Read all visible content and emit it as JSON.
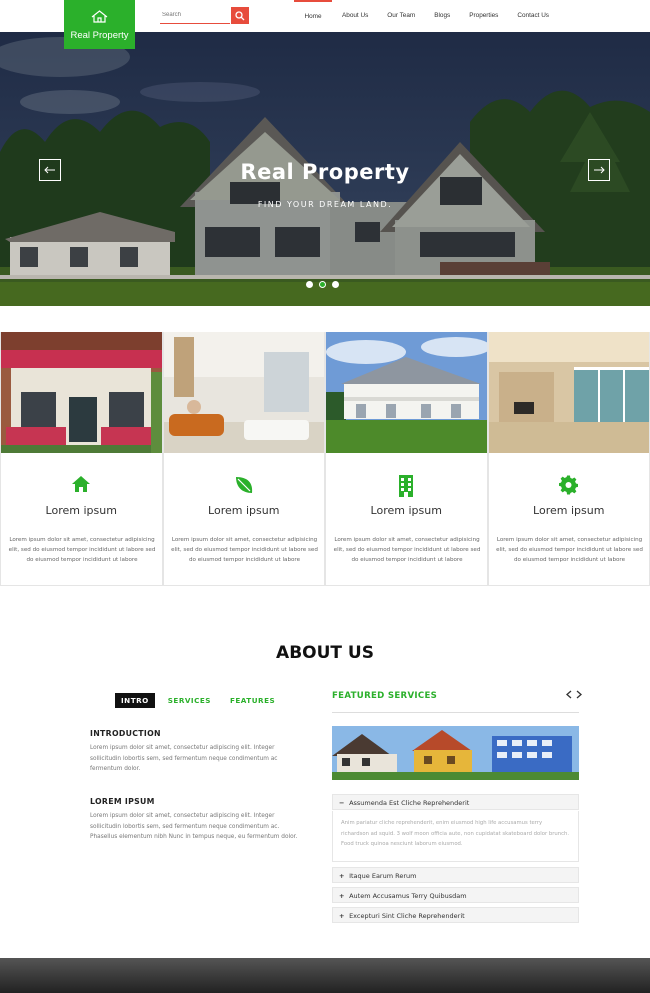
{
  "header": {
    "logo_text": "Real Property",
    "search_placeholder": "Search",
    "nav": [
      "Home",
      "About Us",
      "Our Team",
      "Blogs",
      "Properties",
      "Contact Us"
    ],
    "active_nav": "Home"
  },
  "hero": {
    "title": "Real Property",
    "subtitle": "FIND YOUR DREAM LAND."
  },
  "features": [
    {
      "icon": "home-icon",
      "title": "Lorem ipsum",
      "text": "Lorem ipsum dolor sit amet, consectetur adipisicing elit, sed do eiusmod tempor incididunt ut labore sed do eiusmod tempor incididunt ut labore"
    },
    {
      "icon": "leaf-icon",
      "title": "Lorem ipsum",
      "text": "Lorem ipsum dolor sit amet, consectetur adipisicing elit, sed do eiusmod tempor incididunt ut labore sed do eiusmod tempor incididunt ut labore"
    },
    {
      "icon": "building-icon",
      "title": "Lorem ipsum",
      "text": "Lorem ipsum dolor sit amet, consectetur adipisicing elit, sed do eiusmod tempor incididunt ut labore sed do eiusmod tempor incididunt ut labore"
    },
    {
      "icon": "gear-icon",
      "title": "Lorem ipsum",
      "text": "Lorem ipsum dolor sit amet, consectetur adipisicing elit, sed do eiusmod tempor incididunt ut labore sed do eiusmod tempor incididunt ut labore"
    }
  ],
  "about": {
    "title": "ABOUT US",
    "tabs": [
      "INTRO",
      "SERVICES",
      "FEATURES"
    ],
    "active_tab": "INTRO",
    "blocks": [
      {
        "title": "INTRODUCTION",
        "text": "Lorem ipsum dolor sit amet, consectetur adipiscing elit. Integer sollicitudin lobortis sem, sed fermentum neque condimentum ac fermentum dolor."
      },
      {
        "title": "LOREM IPSUM",
        "text": "Lorem ipsum dolor sit amet, consectetur adipiscing elit. Integer sollicitudin lobortis sem, sed fermentum neque condimentum ac. Phasellus elementum nibh Nunc in tempus neque, eu fermentum dolor."
      }
    ]
  },
  "featured": {
    "title": "FEATURED SERVICES",
    "accordion": [
      {
        "label": "Assumenda Est Cliche Reprehenderit",
        "open": true,
        "symbol": "−"
      },
      {
        "label": "Itaque Earum Rerum",
        "open": false,
        "symbol": "+"
      },
      {
        "label": "Autem Accusamus Terry Quibusdam",
        "open": false,
        "symbol": "+"
      },
      {
        "label": "Excepturi Sint Cliche Reprehenderit",
        "open": false,
        "symbol": "+"
      }
    ],
    "open_text": "Anim pariatur cliche reprehenderit, enim eiusmod high life accusamus terry richardson ad squid. 3 wolf moon officia aute, non cupidatat skateboard dolor brunch. Food truck quinoa nesciunt laborum eiusmod."
  },
  "colors": {
    "accent_green": "#2bb02b",
    "accent_red": "#e74c3c"
  }
}
